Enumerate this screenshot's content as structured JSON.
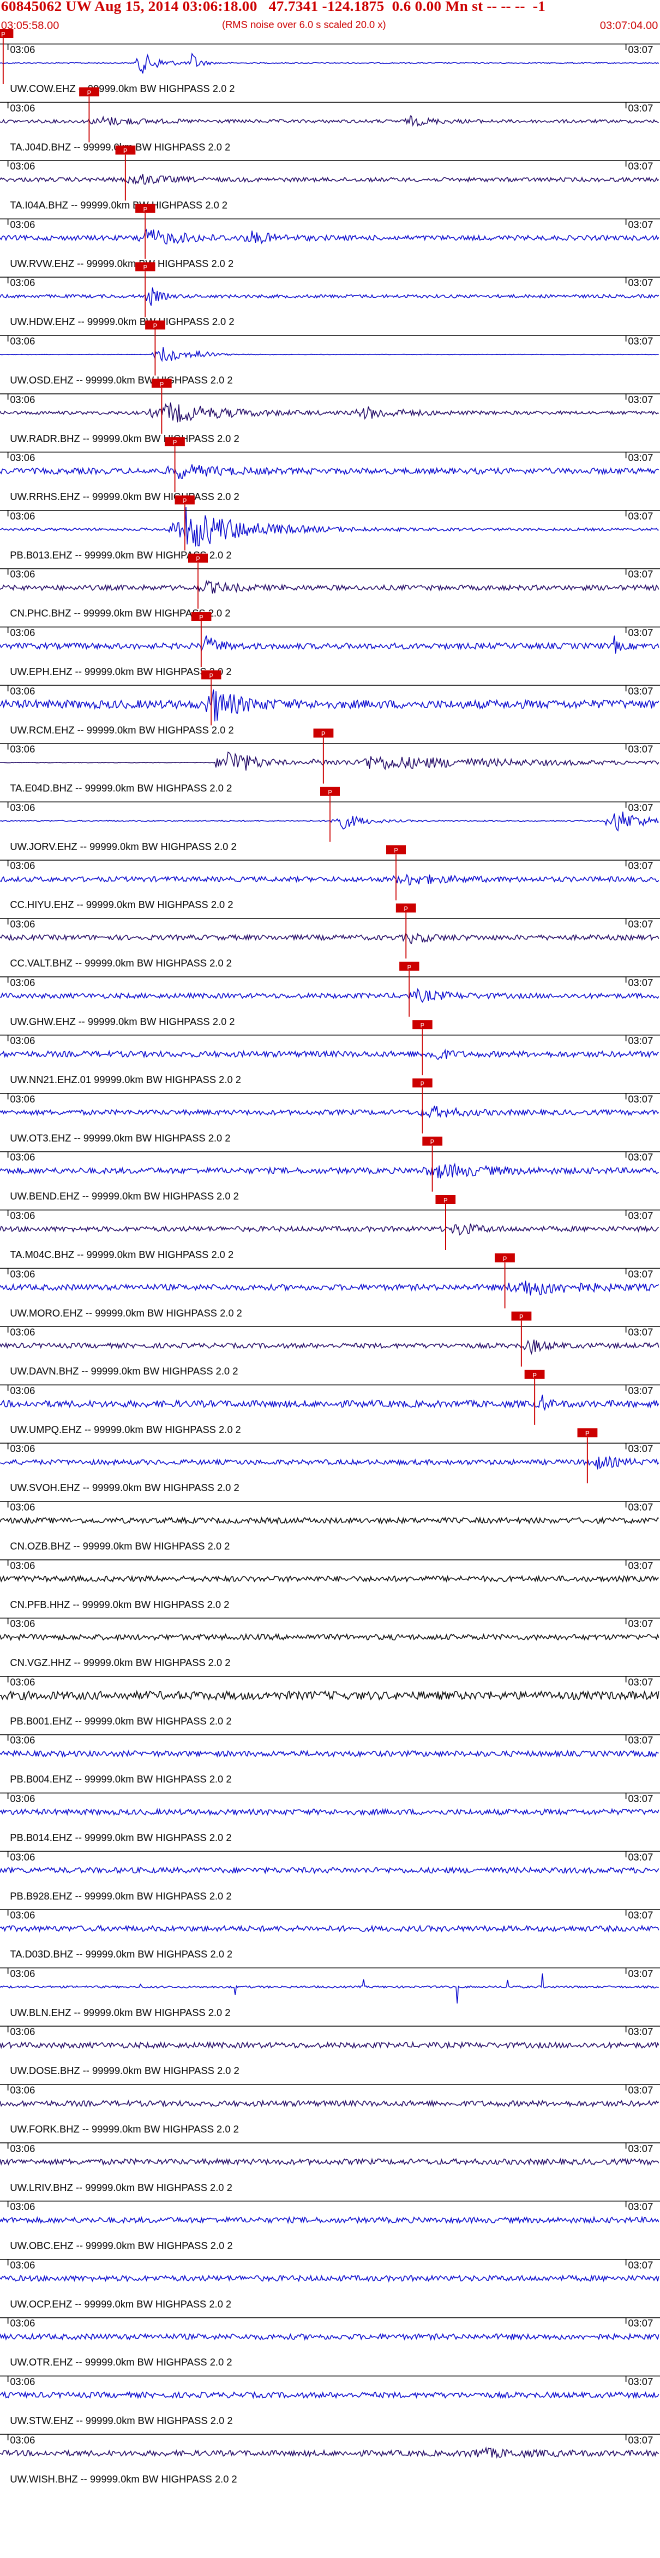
{
  "header": {
    "title": "60845062 UW Aug 15, 2014 03:06:18.00   47.7341 -124.1875  0.6 0.00 Mn st -- -- --  -1",
    "start_time": "03:05:58.00",
    "note": "(RMS noise over 6.0 s scaled 20.0 x)",
    "end_time": "03:07:04.00"
  },
  "chart_data": {
    "type": "line",
    "description_type": "seismogram-record-section",
    "x_unit": "time",
    "time_window": [
      "03:05:58.00",
      "03:07:04.00"
    ],
    "minute_ticks": {
      "left": "03:06",
      "right": "03:07"
    },
    "pick_tag": "P",
    "colors": {
      "header": "#cc0000",
      "pick": "#cc0000",
      "trace_blue": "#0000cc",
      "trace_navy": "#1a0060",
      "trace_black": "#000000",
      "separator": "#000000"
    },
    "channels": [
      {
        "label": "UW.COW.EHZ -- 99999.0km BW  HIGHPASS  2.0  2",
        "color": "blue",
        "pick": 0.005,
        "amp": 0.9,
        "noise": 0.05,
        "bursts": [
          [
            0.21,
            0.04,
            1.0
          ],
          [
            0.29,
            0.015,
            0.9
          ]
        ]
      },
      {
        "label": "TA.J04D.BHZ -- 99999.0km BW  HIGHPASS  2.0  2",
        "color": "navy",
        "pick": 0.135,
        "amp": 0.6,
        "noise": 0.2,
        "bursts": [
          [
            0.15,
            0.08,
            0.5
          ],
          [
            0.62,
            0.05,
            0.5
          ]
        ]
      },
      {
        "label": "TA.I04A.BHZ -- 99999.0km BW  HIGHPASS  2.0  2",
        "color": "navy",
        "pick": 0.19,
        "amp": 0.6,
        "noise": 0.25,
        "bursts": [
          [
            0.2,
            0.06,
            0.7
          ]
        ]
      },
      {
        "label": "UW.RVW.EHZ -- 99999.0km BW  HIGHPASS  2.0  2",
        "color": "blue",
        "pick": 0.22,
        "amp": 0.7,
        "noise": 0.25,
        "bursts": [
          [
            0.22,
            0.08,
            0.8
          ],
          [
            0.38,
            0.05,
            0.5
          ]
        ]
      },
      {
        "label": "UW.HDW.EHZ -- 99999.0km BW  HIGHPASS  2.0  2",
        "color": "blue",
        "pick": 0.22,
        "amp": 0.8,
        "noise": 0.15,
        "bursts": [
          [
            0.225,
            0.02,
            1.0
          ]
        ]
      },
      {
        "label": "UW.OSD.EHZ -- 99999.0km BW  HIGHPASS  2.0  2",
        "color": "blue",
        "pick": 0.235,
        "amp": 0.8,
        "noise": 0.02,
        "bursts": [
          [
            0.24,
            0.05,
            1.0
          ],
          [
            0.3,
            0.02,
            0.4
          ]
        ]
      },
      {
        "label": "UW.RADR.BHZ -- 99999.0km BW  HIGHPASS  2.0  2",
        "color": "navy",
        "pick": 0.245,
        "amp": 0.8,
        "noise": 0.15,
        "bursts": [
          [
            0.25,
            0.12,
            0.9
          ],
          [
            0.55,
            0.08,
            0.5
          ]
        ]
      },
      {
        "label": "UW.RRHS.EHZ -- 99999.0km BW  HIGHPASS  2.0  2",
        "color": "blue",
        "pick": 0.265,
        "amp": 0.7,
        "noise": 0.3,
        "bursts": [
          [
            0.27,
            0.08,
            0.6
          ]
        ]
      },
      {
        "label": "PB.B013.EHZ -- 99999.0km BW  HIGHPASS  2.0  2",
        "color": "blue",
        "pick": 0.28,
        "amp": 1.2,
        "noise": 0.08,
        "bursts": [
          [
            0.28,
            0.12,
            1.3
          ]
        ]
      },
      {
        "label": "CN.PHC.BHZ -- 99999.0km BW  HIGHPASS  2.0  2",
        "color": "navy",
        "pick": 0.3,
        "amp": 0.6,
        "noise": 0.3,
        "bursts": [
          [
            0.31,
            0.06,
            0.6
          ]
        ]
      },
      {
        "label": "UW.EPH.EHZ -- 99999.0km BW  HIGHPASS  2.0  2",
        "color": "blue",
        "pick": 0.305,
        "amp": 0.7,
        "noise": 0.3,
        "bursts": [
          [
            0.31,
            0.03,
            0.9
          ],
          [
            0.93,
            0.01,
            0.9
          ]
        ]
      },
      {
        "label": "UW.RCM.EHZ -- 99999.0km BW  HIGHPASS  2.0  2",
        "color": "blue",
        "pick": 0.32,
        "amp": 1.2,
        "noise": 0.25,
        "bursts": [
          [
            0.32,
            0.05,
            1.0
          ]
        ]
      },
      {
        "label": "TA.E04D.BHZ -- 99999.0km BW  HIGHPASS  2.0  2",
        "color": "navy",
        "pick": 0.49,
        "amp": 0.9,
        "noise": 0.02,
        "bursts": [
          [
            0.34,
            0.07,
            1.3
          ],
          [
            0.55,
            0.4,
            0.6
          ]
        ]
      },
      {
        "label": "UW.JORV.EHZ -- 99999.0km BW  HIGHPASS  2.0  2",
        "color": "blue",
        "pick": 0.5,
        "amp": 0.9,
        "noise": 0.05,
        "bursts": [
          [
            0.51,
            0.05,
            0.8
          ],
          [
            0.93,
            0.06,
            1.0
          ]
        ]
      },
      {
        "label": "CC.HIYU.EHZ -- 99999.0km BW  HIGHPASS  2.0  2",
        "color": "blue",
        "pick": 0.6,
        "amp": 0.6,
        "noise": 0.3,
        "bursts": [
          [
            0.61,
            0.08,
            0.6
          ]
        ]
      },
      {
        "label": "CC.VALT.BHZ -- 99999.0km BW  HIGHPASS  2.0  2",
        "color": "navy",
        "pick": 0.615,
        "amp": 0.6,
        "noise": 0.3,
        "bursts": [
          [
            0.62,
            0.05,
            0.5
          ]
        ]
      },
      {
        "label": "UW.GHW.EHZ -- 99999.0km BW  HIGHPASS  2.0  2",
        "color": "blue",
        "pick": 0.62,
        "amp": 0.6,
        "noise": 0.3,
        "bursts": [
          [
            0.63,
            0.06,
            0.6
          ]
        ]
      },
      {
        "label": "UW.NN21.EHZ.01 99999.0km BW  HIGHPASS  2.0  2",
        "color": "blue",
        "pick": 0.64,
        "amp": 0.7,
        "noise": 0.3,
        "bursts": [
          [
            0.655,
            0.02,
            1.0
          ]
        ]
      },
      {
        "label": "UW.OT3.EHZ -- 99999.0km BW  HIGHPASS  2.0  2",
        "color": "blue",
        "pick": 0.64,
        "amp": 0.6,
        "noise": 0.3,
        "bursts": [
          [
            0.65,
            0.06,
            0.6
          ]
        ]
      },
      {
        "label": "UW.BEND.EHZ -- 99999.0km BW  HIGHPASS  2.0  2",
        "color": "blue",
        "pick": 0.655,
        "amp": 0.7,
        "noise": 0.3,
        "bursts": [
          [
            0.66,
            0.1,
            0.6
          ]
        ]
      },
      {
        "label": "TA.M04C.BHZ -- 99999.0km BW  HIGHPASS  2.0  2",
        "color": "navy",
        "pick": 0.675,
        "amp": 0.6,
        "noise": 0.3,
        "bursts": [
          [
            0.69,
            0.04,
            0.8
          ]
        ]
      },
      {
        "label": "UW.MORO.EHZ -- 99999.0km BW  HIGHPASS  2.0  2",
        "color": "blue",
        "pick": 0.765,
        "amp": 0.7,
        "noise": 0.3,
        "bursts": [
          [
            0.79,
            0.1,
            0.8
          ]
        ]
      },
      {
        "label": "UW.DAVN.BHZ -- 99999.0km BW  HIGHPASS  2.0  2",
        "color": "navy",
        "pick": 0.79,
        "amp": 0.7,
        "noise": 0.25,
        "bursts": [
          [
            0.8,
            0.03,
            0.8
          ]
        ]
      },
      {
        "label": "UW.UMPQ.EHZ -- 99999.0km BW  HIGHPASS  2.0  2",
        "color": "blue",
        "pick": 0.81,
        "amp": 0.8,
        "noise": 0.3,
        "bursts": [
          [
            0.82,
            0.01,
            0.9
          ]
        ]
      },
      {
        "label": "UW.SVOH.EHZ -- 99999.0km BW  HIGHPASS  2.0  2",
        "color": "blue",
        "pick": 0.89,
        "amp": 0.6,
        "noise": 0.3,
        "bursts": [
          [
            0.9,
            0.05,
            0.7
          ]
        ]
      },
      {
        "label": "CN.OZB.BHZ -- 99999.0km BW  HIGHPASS  2.0  2",
        "color": "black",
        "pick": null,
        "amp": 0.5,
        "noise": 0.4,
        "bursts": []
      },
      {
        "label": "CN.PFB.HHZ -- 99999.0km BW  HIGHPASS  2.0  2",
        "color": "black",
        "pick": null,
        "amp": 0.5,
        "noise": 0.4,
        "bursts": []
      },
      {
        "label": "CN.VGZ.HHZ -- 99999.0km BW  HIGHPASS  2.0  2",
        "color": "black",
        "pick": null,
        "amp": 0.5,
        "noise": 0.4,
        "bursts": []
      },
      {
        "label": "PB.B001.EHZ -- 99999.0km BW  HIGHPASS  2.0  2",
        "color": "black",
        "pick": null,
        "amp": 0.5,
        "noise": 0.6,
        "bursts": []
      },
      {
        "label": "PB.B004.EHZ -- 99999.0km BW  HIGHPASS  2.0  2",
        "color": "blue",
        "pick": null,
        "amp": 0.5,
        "noise": 0.4,
        "bursts": []
      },
      {
        "label": "PB.B014.EHZ -- 99999.0km BW  HIGHPASS  2.0  2",
        "color": "blue",
        "pick": null,
        "amp": 0.5,
        "noise": 0.4,
        "bursts": []
      },
      {
        "label": "PB.B928.EHZ -- 99999.0km BW  HIGHPASS  2.0  2",
        "color": "blue",
        "pick": null,
        "amp": 0.5,
        "noise": 0.4,
        "bursts": []
      },
      {
        "label": "TA.D03D.BHZ -- 99999.0km BW  HIGHPASS  2.0  2",
        "color": "blue",
        "pick": null,
        "amp": 0.5,
        "noise": 0.4,
        "bursts": []
      },
      {
        "label": "UW.BLN.EHZ -- 99999.0km BW  HIGHPASS  2.0  2",
        "color": "blue",
        "pick": null,
        "amp": 0.5,
        "noise": 0.15,
        "bursts": [],
        "spikes": true
      },
      {
        "label": "UW.DOSE.BHZ -- 99999.0km BW  HIGHPASS  2.0  2",
        "color": "navy",
        "pick": null,
        "amp": 0.5,
        "noise": 0.4,
        "bursts": []
      },
      {
        "label": "UW.FORK.BHZ -- 99999.0km BW  HIGHPASS  2.0  2",
        "color": "navy",
        "pick": null,
        "amp": 0.5,
        "noise": 0.4,
        "bursts": []
      },
      {
        "label": "UW.LRIV.BHZ -- 99999.0km BW  HIGHPASS  2.0  2",
        "color": "navy",
        "pick": null,
        "amp": 0.5,
        "noise": 0.4,
        "bursts": []
      },
      {
        "label": "UW.OBC.EHZ -- 99999.0km BW  HIGHPASS  2.0  2",
        "color": "blue",
        "pick": null,
        "amp": 0.5,
        "noise": 0.4,
        "bursts": []
      },
      {
        "label": "UW.OCP.EHZ -- 99999.0km BW  HIGHPASS  2.0  2",
        "color": "blue",
        "pick": null,
        "amp": 0.5,
        "noise": 0.4,
        "bursts": []
      },
      {
        "label": "UW.OTR.EHZ -- 99999.0km BW  HIGHPASS  2.0  2",
        "color": "blue",
        "pick": null,
        "amp": 0.5,
        "noise": 0.4,
        "bursts": []
      },
      {
        "label": "UW.STW.EHZ -- 99999.0km BW  HIGHPASS  2.0  2",
        "color": "blue",
        "pick": null,
        "amp": 0.5,
        "noise": 0.4,
        "bursts": []
      },
      {
        "label": "UW.WISH.BHZ -- 99999.0km BW  HIGHPASS  2.0  2",
        "color": "navy",
        "pick": null,
        "amp": 0.5,
        "noise": 0.4,
        "bursts": [
          [
            0.72,
            0.1,
            0.5
          ]
        ]
      }
    ]
  }
}
